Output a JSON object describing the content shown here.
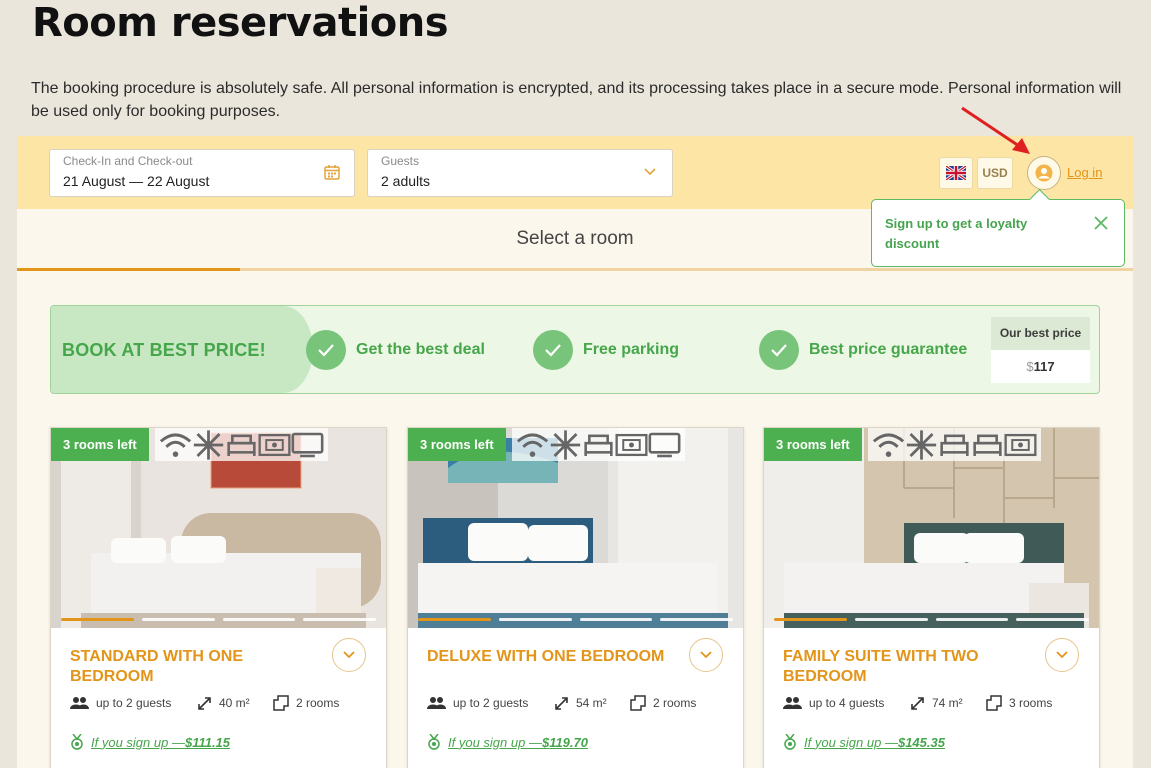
{
  "page": {
    "title": "Room reservations",
    "intro": "The booking procedure is absolutely safe. All personal information is encrypted, and its processing takes place in a secure mode. Personal information will be used only for booking purposes."
  },
  "search": {
    "dates_label": "Check-In and Check-out",
    "dates_value": "21 August — 22 August",
    "guests_label": "Guests",
    "guests_value": "2 adults"
  },
  "header": {
    "language_flag": "uk-flag-icon",
    "currency": "USD",
    "login_label": "Log in"
  },
  "tooltip": {
    "text": "Sign up to get a loyalty discount"
  },
  "select_room": {
    "title": "Select a room"
  },
  "promo": {
    "title": "BOOK AT BEST PRICE!",
    "perks": [
      "Get the best deal",
      "Free parking",
      "Best price guarantee"
    ],
    "best_price_label": "Our best price",
    "best_price_currency": "$",
    "best_price_value": "117"
  },
  "rooms": [
    {
      "badge": "3 rooms left",
      "amenities": [
        "wifi-icon",
        "snowflake-icon",
        "bed-icon",
        "safe-icon",
        "tv-icon"
      ],
      "name": "STANDARD WITH ONE BEDROOM",
      "guests": "up to 2 guests",
      "area": "40 m²",
      "rooms": "2 rooms",
      "signup_text": "If you sign up — ",
      "signup_currency": "$",
      "signup_price": "111.15"
    },
    {
      "badge": "3 rooms left",
      "amenities": [
        "wifi-icon",
        "snowflake-icon",
        "bed-icon",
        "safe-icon",
        "tv-icon"
      ],
      "name": "DELUXE WITH ONE BEDROOM",
      "guests": "up to 2 guests",
      "area": "54 m²",
      "rooms": "2 rooms",
      "signup_text": "If you sign up — ",
      "signup_currency": "$",
      "signup_price": "119.70"
    },
    {
      "badge": "3 rooms left",
      "amenities": [
        "wifi-icon",
        "snowflake-icon",
        "bed-icon",
        "bed-icon",
        "safe-icon"
      ],
      "name": "FAMILY SUITE WITH TWO BEDROOM",
      "guests": "up to 4 guests",
      "area": "74 m²",
      "rooms": "3 rooms",
      "signup_text": "If you sign up — ",
      "signup_currency": "$",
      "signup_price": "145.35"
    }
  ],
  "colors": {
    "accent": "#e3951a",
    "green": "#4caf50",
    "search_bar": "#fde5a6",
    "page_bg": "#ebe6dc"
  }
}
